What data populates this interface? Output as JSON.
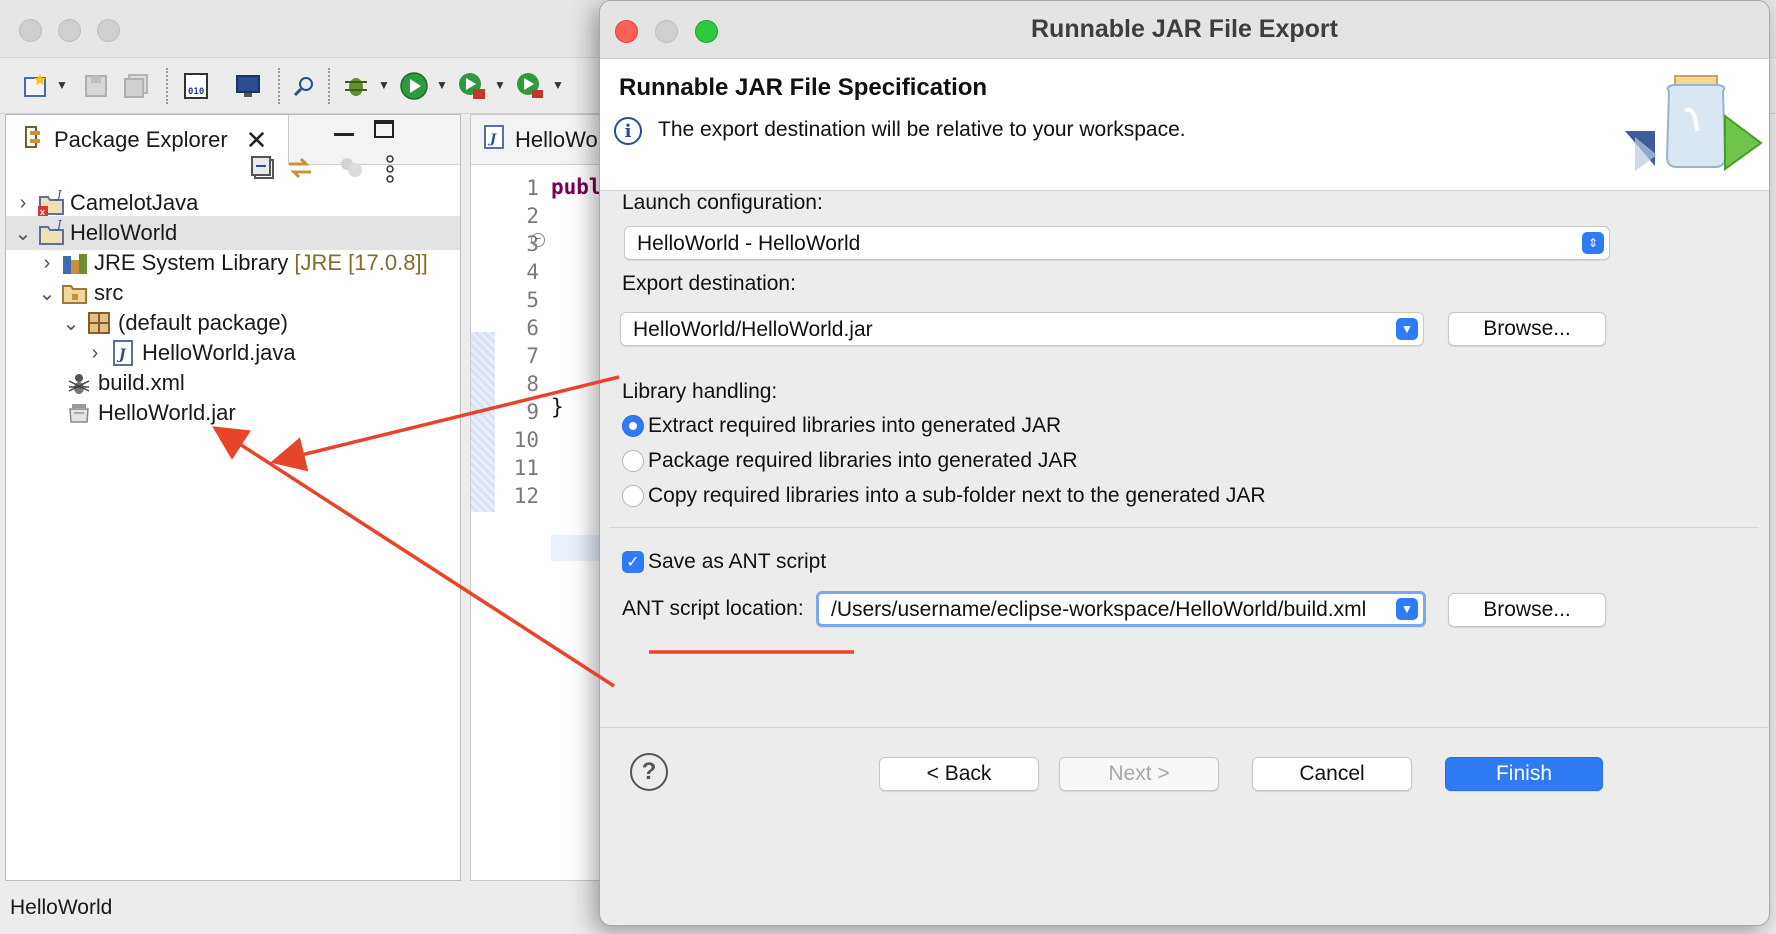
{
  "eclipse": {
    "package_explorer": {
      "tab_label": "Package Explorer",
      "tree": [
        {
          "label": "CamelotJava",
          "decor": ""
        },
        {
          "label": "HelloWorld",
          "decor": ""
        },
        {
          "label": "JRE System Library",
          "decor": "[JRE [17.0.8]]"
        },
        {
          "label": "src",
          "decor": ""
        },
        {
          "label": "(default package)",
          "decor": ""
        },
        {
          "label": "HelloWorld.java",
          "decor": ""
        },
        {
          "label": "build.xml",
          "decor": ""
        },
        {
          "label": "HelloWorld.jar",
          "decor": ""
        }
      ]
    },
    "editor": {
      "tab_label": "HelloWo",
      "line_numbers": [
        "1",
        "2",
        "3",
        "4",
        "5",
        "6",
        "7",
        "8",
        "9",
        "10",
        "11",
        "12"
      ],
      "code_line_2": "publ",
      "code_line_11": "}"
    },
    "status": "HelloWorld"
  },
  "dialog": {
    "window_title": "Runnable JAR File Export",
    "header_title": "Runnable JAR File Specification",
    "header_message": "The export destination will be relative to your workspace.",
    "launch_label": "Launch configuration:",
    "launch_value": "HelloWorld - HelloWorld",
    "export_label": "Export destination:",
    "export_value": "HelloWorld/HelloWorld.jar",
    "browse_label": "Browse...",
    "library_label": "Library handling:",
    "library_options": [
      {
        "label": "Extract required libraries into generated JAR",
        "selected": true
      },
      {
        "label": "Package required libraries into generated JAR",
        "selected": false
      },
      {
        "label": "Copy required libraries into a sub-folder next to the generated JAR",
        "selected": false
      }
    ],
    "save_ant_label": "Save as ANT script",
    "save_ant_checked": true,
    "ant_location_label": "ANT script location:",
    "ant_location_value": "/Users/username/eclipse-workspace/HelloWorld/build.xml",
    "buttons": {
      "back": "< Back",
      "next": "Next >",
      "cancel": "Cancel",
      "finish": "Finish"
    }
  },
  "colors": {
    "accent": "#2f7bf5",
    "annotation": "#e8442c",
    "keyword": "#7a0055"
  },
  "icons": [
    "new-icon",
    "save-icon",
    "save-all-icon",
    "binary-icon",
    "console-icon",
    "search-icon",
    "debug-icon",
    "run-icon",
    "coverage-icon",
    "external-tools-icon",
    "collapse-all-icon",
    "link-editor-icon",
    "filter-icon",
    "view-menu-icon",
    "minimize-icon",
    "maximize-icon",
    "close-icon",
    "info-icon",
    "jar-wizard-icon",
    "help-icon"
  ]
}
